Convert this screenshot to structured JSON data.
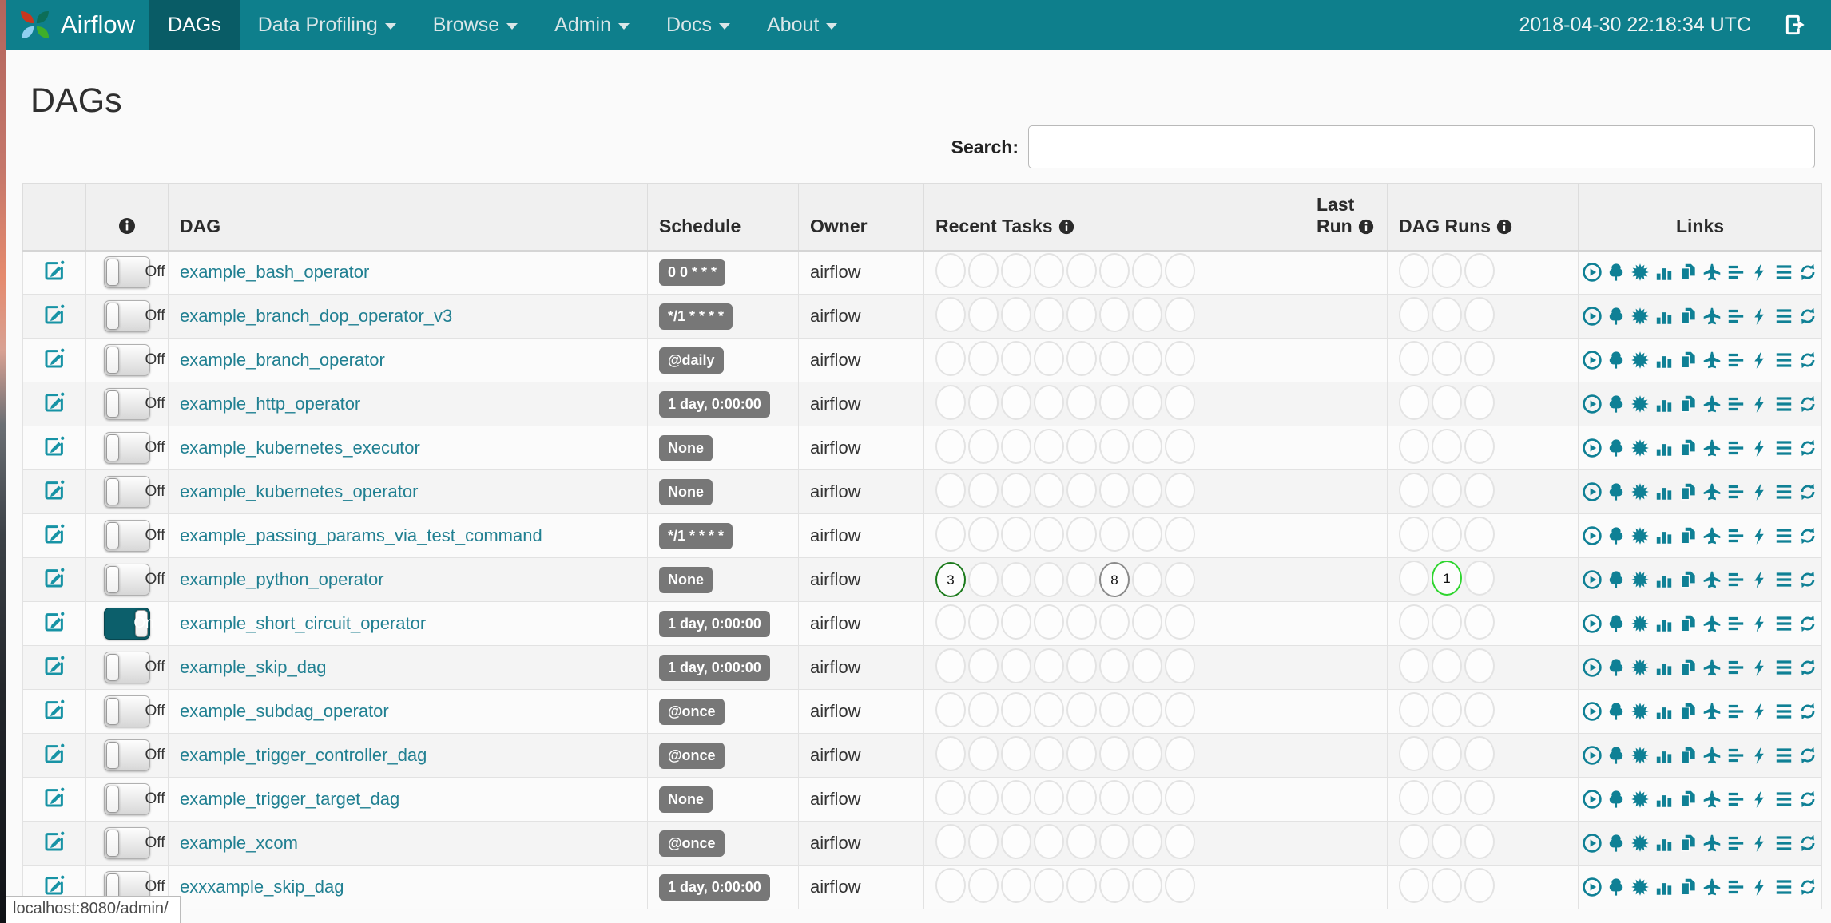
{
  "navbar": {
    "brand": "Airflow",
    "items": [
      {
        "label": "DAGs",
        "active": true,
        "caret": false
      },
      {
        "label": "Data Profiling",
        "active": false,
        "caret": true
      },
      {
        "label": "Browse",
        "active": false,
        "caret": true
      },
      {
        "label": "Admin",
        "active": false,
        "caret": true
      },
      {
        "label": "Docs",
        "active": false,
        "caret": true
      },
      {
        "label": "About",
        "active": false,
        "caret": true
      }
    ],
    "clock": "2018-04-30 22:18:34 UTC"
  },
  "page": {
    "title": "DAGs"
  },
  "search": {
    "label": "Search:",
    "value": ""
  },
  "table": {
    "headers": {
      "dag": "DAG",
      "schedule": "Schedule",
      "owner": "Owner",
      "recent_tasks": "Recent Tasks",
      "last_run_line1": "Last",
      "last_run_line2": "Run",
      "dag_runs": "DAG Runs",
      "links": "Links"
    },
    "link_icons": [
      "trigger-dag",
      "tree-view",
      "graph-view",
      "task-duration",
      "task-tries",
      "landing-times",
      "gantt",
      "code-view",
      "logs",
      "refresh"
    ],
    "rows": [
      {
        "name": "example_bash_operator",
        "toggle": "Off",
        "schedule": "0 0 * * *",
        "owner": "airflow",
        "last_run": "",
        "recent_tasks": [
          null,
          null,
          null,
          null,
          null,
          null,
          null,
          null
        ],
        "dag_runs": [
          null,
          null,
          null
        ]
      },
      {
        "name": "example_branch_dop_operator_v3",
        "toggle": "Off",
        "schedule": "*/1 * * * *",
        "owner": "airflow",
        "last_run": "",
        "recent_tasks": [
          null,
          null,
          null,
          null,
          null,
          null,
          null,
          null
        ],
        "dag_runs": [
          null,
          null,
          null
        ]
      },
      {
        "name": "example_branch_operator",
        "toggle": "Off",
        "schedule": "@daily",
        "owner": "airflow",
        "last_run": "",
        "recent_tasks": [
          null,
          null,
          null,
          null,
          null,
          null,
          null,
          null
        ],
        "dag_runs": [
          null,
          null,
          null
        ]
      },
      {
        "name": "example_http_operator",
        "toggle": "Off",
        "schedule": "1 day, 0:00:00",
        "owner": "airflow",
        "last_run": "",
        "recent_tasks": [
          null,
          null,
          null,
          null,
          null,
          null,
          null,
          null
        ],
        "dag_runs": [
          null,
          null,
          null
        ]
      },
      {
        "name": "example_kubernetes_executor",
        "toggle": "Off",
        "schedule": "None",
        "owner": "airflow",
        "last_run": "",
        "recent_tasks": [
          null,
          null,
          null,
          null,
          null,
          null,
          null,
          null
        ],
        "dag_runs": [
          null,
          null,
          null
        ]
      },
      {
        "name": "example_kubernetes_operator",
        "toggle": "Off",
        "schedule": "None",
        "owner": "airflow",
        "last_run": "",
        "recent_tasks": [
          null,
          null,
          null,
          null,
          null,
          null,
          null,
          null
        ],
        "dag_runs": [
          null,
          null,
          null
        ]
      },
      {
        "name": "example_passing_params_via_test_command",
        "toggle": "Off",
        "schedule": "*/1 * * * *",
        "owner": "airflow",
        "last_run": "",
        "recent_tasks": [
          null,
          null,
          null,
          null,
          null,
          null,
          null,
          null
        ],
        "dag_runs": [
          null,
          null,
          null
        ]
      },
      {
        "name": "example_python_operator",
        "toggle": "Off",
        "schedule": "None",
        "owner": "airflow",
        "last_run": "",
        "recent_tasks": [
          {
            "count": "3",
            "status": "success"
          },
          null,
          null,
          null,
          null,
          {
            "count": "8",
            "status": "none"
          },
          null,
          null
        ],
        "dag_runs": [
          null,
          {
            "count": "1",
            "status": "running"
          },
          null
        ]
      },
      {
        "name": "example_short_circuit_operator",
        "toggle": "On",
        "schedule": "1 day, 0:00:00",
        "owner": "airflow",
        "last_run": "",
        "recent_tasks": [
          null,
          null,
          null,
          null,
          null,
          null,
          null,
          null
        ],
        "dag_runs": [
          null,
          null,
          null
        ]
      },
      {
        "name": "example_skip_dag",
        "toggle": "Off",
        "schedule": "1 day, 0:00:00",
        "owner": "airflow",
        "last_run": "",
        "recent_tasks": [
          null,
          null,
          null,
          null,
          null,
          null,
          null,
          null
        ],
        "dag_runs": [
          null,
          null,
          null
        ]
      },
      {
        "name": "example_subdag_operator",
        "toggle": "Off",
        "schedule": "@once",
        "owner": "airflow",
        "last_run": "",
        "recent_tasks": [
          null,
          null,
          null,
          null,
          null,
          null,
          null,
          null
        ],
        "dag_runs": [
          null,
          null,
          null
        ]
      },
      {
        "name": "example_trigger_controller_dag",
        "toggle": "Off",
        "schedule": "@once",
        "owner": "airflow",
        "last_run": "",
        "recent_tasks": [
          null,
          null,
          null,
          null,
          null,
          null,
          null,
          null
        ],
        "dag_runs": [
          null,
          null,
          null
        ]
      },
      {
        "name": "example_trigger_target_dag",
        "toggle": "Off",
        "schedule": "None",
        "owner": "airflow",
        "last_run": "",
        "recent_tasks": [
          null,
          null,
          null,
          null,
          null,
          null,
          null,
          null
        ],
        "dag_runs": [
          null,
          null,
          null
        ]
      },
      {
        "name": "example_xcom",
        "toggle": "Off",
        "schedule": "@once",
        "owner": "airflow",
        "last_run": "",
        "recent_tasks": [
          null,
          null,
          null,
          null,
          null,
          null,
          null,
          null
        ],
        "dag_runs": [
          null,
          null,
          null
        ]
      },
      {
        "name": "exxxample_skip_dag",
        "toggle": "Off",
        "schedule": "1 day, 0:00:00",
        "owner": "airflow",
        "last_run": "",
        "recent_tasks": [
          null,
          null,
          null,
          null,
          null,
          null,
          null,
          null
        ],
        "dag_runs": [
          null,
          null,
          null
        ]
      }
    ]
  },
  "status_bar": {
    "url": "localhost:8080/admin/"
  },
  "colors": {
    "navbar": "#0e7f8c",
    "navbar_active": "#095c66",
    "link": "#218092",
    "icon_teal": "#0f8095",
    "badge": "#777777",
    "task_success": "#1b7a1b",
    "task_none": "#8a8a8a",
    "dagrun_running": "#2fd52f"
  }
}
